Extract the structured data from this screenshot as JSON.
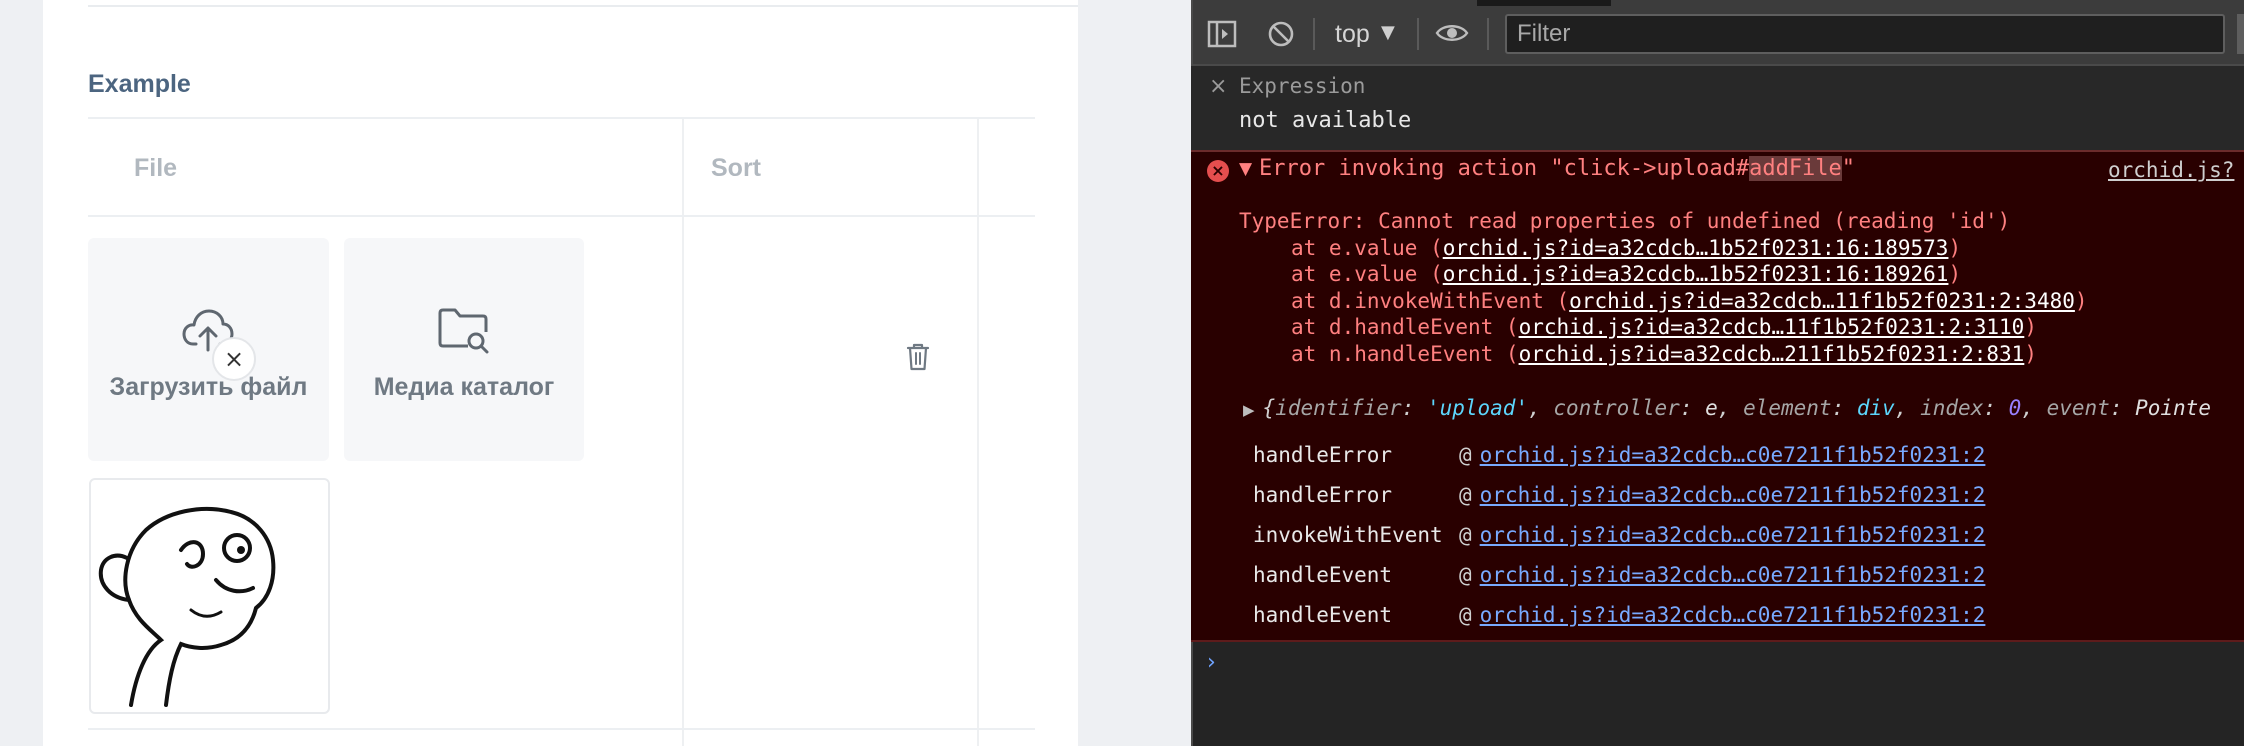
{
  "section": {
    "title": "Example"
  },
  "table": {
    "columns": [
      "File",
      "Sort"
    ]
  },
  "upload_tile": {
    "label": "Загрузить файл",
    "icon": "cloud-upload-icon"
  },
  "media_tile": {
    "label": "Медиа каталог",
    "icon": "folder-search-icon"
  },
  "thumbnail": {
    "remove_label": "×"
  },
  "devtools": {
    "toolbar": {
      "context": "top",
      "filter_placeholder": "Filter"
    },
    "expression": {
      "label": "Expression",
      "value": "not available",
      "close": "×"
    },
    "error": {
      "message_prefix": "Error invoking action \"click->upload#",
      "message_highlight": "addFile",
      "message_suffix": "\"",
      "source": "orchid.js?",
      "stack": [
        {
          "text": "TypeError: Cannot read properties of undefined (reading 'id')",
          "indent": false,
          "link": ""
        },
        {
          "text": "at e.value (",
          "indent": true,
          "link": "orchid.js?id=a32cdcb…1b52f0231:16:189573"
        },
        {
          "text": "at e.value (",
          "indent": true,
          "link": "orchid.js?id=a32cdcb…1b52f0231:16:189261"
        },
        {
          "text": "at d.invokeWithEvent (",
          "indent": true,
          "link": "orchid.js?id=a32cdcb…11f1b52f0231:2:3480"
        },
        {
          "text": "at d.handleEvent (",
          "indent": true,
          "link": "orchid.js?id=a32cdcb…11f1b52f0231:2:3110"
        },
        {
          "text": "at n.handleEvent (",
          "indent": true,
          "link": "orchid.js?id=a32cdcb…211f1b52f0231:2:831"
        }
      ],
      "object_preview": {
        "identifier_key": "identifier",
        "identifier_val": "'upload'",
        "controller_key": "controller",
        "controller_val": "e",
        "element_key": "element",
        "element_val": "div",
        "index_key": "index",
        "index_val": "0",
        "event_key": "event",
        "event_val": "Pointe"
      },
      "trace": [
        {
          "fn": "handleError",
          "link": "orchid.js?id=a32cdcb…c0e7211f1b52f0231:2"
        },
        {
          "fn": "handleError",
          "link": "orchid.js?id=a32cdcb…c0e7211f1b52f0231:2"
        },
        {
          "fn": "invokeWithEvent",
          "link": "orchid.js?id=a32cdcb…c0e7211f1b52f0231:2"
        },
        {
          "fn": "handleEvent",
          "link": "orchid.js?id=a32cdcb…c0e7211f1b52f0231:2"
        },
        {
          "fn": "handleEvent",
          "link": "orchid.js?id=a32cdcb…c0e7211f1b52f0231:2"
        }
      ],
      "trace_at": "@"
    },
    "prompt": "›"
  }
}
